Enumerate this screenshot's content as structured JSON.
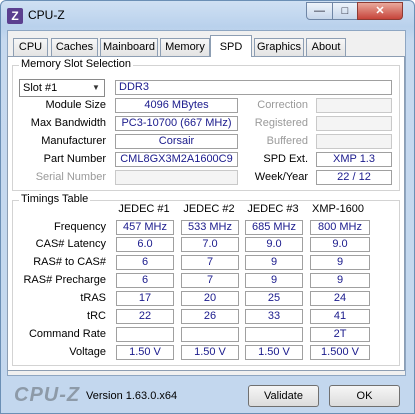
{
  "window": {
    "title": "CPU-Z",
    "icon_letter": "Z"
  },
  "caption_buttons": {
    "minimize": "—",
    "maximize": "□",
    "close": "✕"
  },
  "tabs": [
    "CPU",
    "Caches",
    "Mainboard",
    "Memory",
    "SPD",
    "Graphics",
    "About"
  ],
  "active_tab": "SPD",
  "memory_slot": {
    "group_title": "Memory Slot Selection",
    "slot_selected": "Slot #1",
    "type": "DDR3",
    "labels": {
      "module_size": "Module Size",
      "max_bandwidth": "Max Bandwidth",
      "manufacturer": "Manufacturer",
      "part_number": "Part Number",
      "serial_number": "Serial Number",
      "correction": "Correction",
      "registered": "Registered",
      "buffered": "Buffered",
      "spd_ext": "SPD Ext.",
      "week_year": "Week/Year"
    },
    "values": {
      "module_size": "4096 MBytes",
      "max_bandwidth": "PC3-10700 (667 MHz)",
      "manufacturer": "Corsair",
      "part_number": "CML8GX3M2A1600C9",
      "serial_number": "",
      "correction": "",
      "registered": "",
      "buffered": "",
      "spd_ext": "XMP 1.3",
      "week_year": "22 / 12"
    }
  },
  "timings": {
    "group_title": "Timings Table",
    "columns": [
      "JEDEC #1",
      "JEDEC #2",
      "JEDEC #3",
      "XMP-1600"
    ],
    "rows": [
      {
        "label": "Frequency",
        "values": [
          "457 MHz",
          "533 MHz",
          "685 MHz",
          "800 MHz"
        ]
      },
      {
        "label": "CAS# Latency",
        "values": [
          "6.0",
          "7.0",
          "9.0",
          "9.0"
        ]
      },
      {
        "label": "RAS# to CAS#",
        "values": [
          "6",
          "7",
          "9",
          "9"
        ]
      },
      {
        "label": "RAS# Precharge",
        "values": [
          "6",
          "7",
          "9",
          "9"
        ]
      },
      {
        "label": "tRAS",
        "values": [
          "17",
          "20",
          "25",
          "24"
        ]
      },
      {
        "label": "tRC",
        "values": [
          "22",
          "26",
          "33",
          "41"
        ]
      },
      {
        "label": "Command Rate",
        "values": [
          "",
          "",
          "",
          "2T"
        ]
      },
      {
        "label": "Voltage",
        "values": [
          "1.50 V",
          "1.50 V",
          "1.50 V",
          "1.500 V"
        ]
      }
    ]
  },
  "footer": {
    "logo": "CPU-Z",
    "version": "Version 1.63.0.x64",
    "validate_label": "Validate",
    "ok_label": "OK"
  }
}
